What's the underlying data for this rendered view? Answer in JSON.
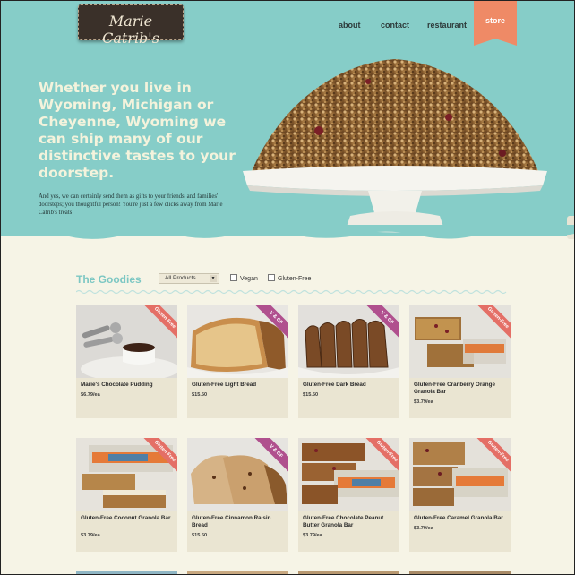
{
  "header": {
    "logo_text": "Marie Catrib's",
    "nav": [
      {
        "label": "about"
      },
      {
        "label": "contact"
      },
      {
        "label": "restaurant"
      },
      {
        "label": "store"
      }
    ]
  },
  "hero": {
    "headline": "Whether you live in Wyoming, Michigan or Cheyenne, Wyoming we can ship many of our distinctive tastes to your doorstep.",
    "subtext": "And yes, we can certainly send them as gifts to your friends' and families' doorsteps; you thoughtful person! You're just a few clicks away from Marie Catrib's treats!"
  },
  "filters": {
    "title": "The Goodies",
    "select_value": "All Products",
    "vegan_label": "Vegan",
    "gluten_free_label": "Gluten-Free"
  },
  "products": [
    {
      "name": "Marie's Chocolate Pudding",
      "price": "$6.79/ea",
      "ribbon": "Gluten-Free"
    },
    {
      "name": "Gluten-Free Light Bread",
      "price": "$15.50",
      "ribbon": "V & GF"
    },
    {
      "name": "Gluten-Free Dark Bread",
      "price": "$15.50",
      "ribbon": "V & GF"
    },
    {
      "name": "Gluten-Free Cranberry Orange Granola Bar",
      "price": "$3.79/ea",
      "ribbon": "Gluten-Free"
    },
    {
      "name": "Gluten-Free Coconut Granola Bar",
      "price": "$3.79/ea",
      "ribbon": "Gluten-Free"
    },
    {
      "name": "Gluten-Free Cinnamon Raisin Bread",
      "price": "$15.50",
      "ribbon": "V & GF"
    },
    {
      "name": "Gluten-Free Chocolate Peanut Butter Granola Bar",
      "price": "$3.79/ea",
      "ribbon": "Gluten-Free"
    },
    {
      "name": "Gluten-Free Caramel Granola Bar",
      "price": "$3.79/ea",
      "ribbon": "Gluten-Free"
    }
  ],
  "colors": {
    "hero_bg": "#86cdc8",
    "store_tab": "#ef8a66",
    "gluten_free_ribbon": "#e46f66",
    "vegan_ribbon": "#b0508e",
    "page_bg": "#f6f4e6"
  }
}
